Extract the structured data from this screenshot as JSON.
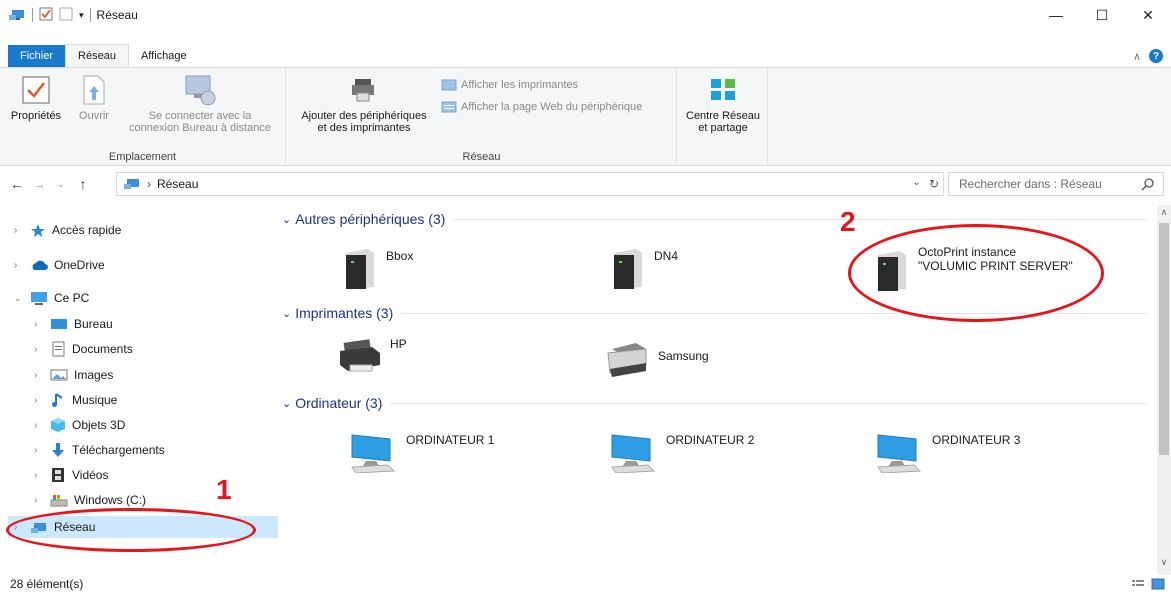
{
  "window": {
    "title": "Réseau",
    "minimize": "—",
    "maximize": "☐",
    "close": "✕"
  },
  "tabs": {
    "file": "Fichier",
    "network": "Réseau",
    "view": "Affichage"
  },
  "ribbon": {
    "properties": "Propriétés",
    "open": "Ouvrir",
    "remote_line1": "Se connecter avec la",
    "remote_line2": "connexion Bureau à distance",
    "group_location": "Emplacement",
    "add_devices_line1": "Ajouter des périphériques",
    "add_devices_line2": "et des imprimantes",
    "show_printers": "Afficher les imprimantes",
    "show_device_web": "Afficher la page Web du périphérique",
    "network_center_line1": "Centre Réseau",
    "network_center_line2": "et partage",
    "group_network": "Réseau"
  },
  "address": {
    "path": "Réseau",
    "search_placeholder": "Rechercher dans : Réseau"
  },
  "nav": {
    "quick_access": "Accès rapide",
    "onedrive": "OneDrive",
    "this_pc": "Ce PC",
    "desktop": "Bureau",
    "documents": "Documents",
    "images": "Images",
    "music": "Musique",
    "objects3d": "Objets 3D",
    "downloads": "Téléchargements",
    "videos": "Vidéos",
    "windows_c": "Windows (C:)",
    "network": "Réseau"
  },
  "groups": {
    "other_devices": "Autres périphériques (3)",
    "printers": "Imprimantes (3)",
    "computers": "Ordinateur (3)"
  },
  "items": {
    "bbox": "Bbox",
    "dn4": "DN4",
    "octoprint_line1": "OctoPrint instance",
    "octoprint_line2": "\"VOLUMIC PRINT SERVER\"",
    "hp": "HP",
    "samsung": "Samsung",
    "pc1": "ORDINATEUR 1",
    "pc2": "ORDINATEUR 2",
    "pc3": "ORDINATEUR 3"
  },
  "status": {
    "count": "28 élément(s)"
  },
  "annotations": {
    "one": "1",
    "two": "2",
    "color": "#e8141c"
  }
}
